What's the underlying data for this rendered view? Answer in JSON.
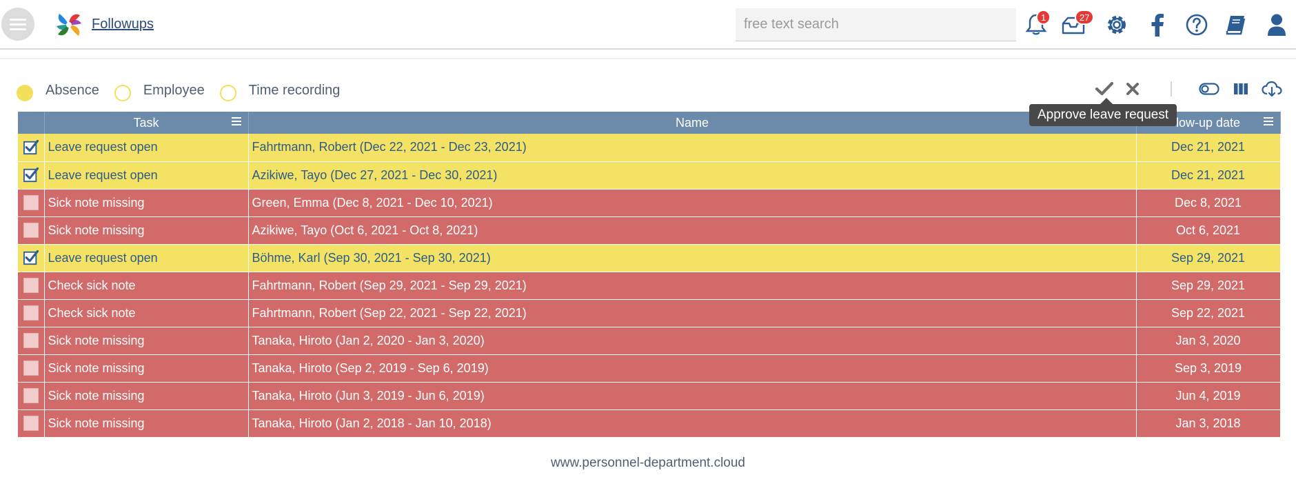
{
  "header": {
    "title": "Followups",
    "search_placeholder": "free text search",
    "notifications_count": "1",
    "messages_count": "27"
  },
  "filters": [
    {
      "label": "Absence",
      "selected": true
    },
    {
      "label": "Employee",
      "selected": false
    },
    {
      "label": "Time recording",
      "selected": false
    }
  ],
  "toolbar": {
    "tooltip": "Approve leave request"
  },
  "table": {
    "columns": {
      "task": "Task",
      "name": "Name",
      "date": "low-up date"
    },
    "rows": [
      {
        "checked": true,
        "task": "Leave request open",
        "name": "Fahrtmann, Robert (Dec 22, 2021 - Dec 23, 2021)",
        "date": "Dec 21, 2021",
        "status": "yellow"
      },
      {
        "checked": true,
        "task": "Leave request open",
        "name": "Azikiwe, Tayo (Dec 27, 2021 - Dec 30, 2021)",
        "date": "Dec 21, 2021",
        "status": "yellow"
      },
      {
        "checked": false,
        "task": "Sick note missing",
        "name": "Green, Emma (Dec 8, 2021 - Dec 10, 2021)",
        "date": "Dec 8, 2021",
        "status": "red"
      },
      {
        "checked": false,
        "task": "Sick note missing",
        "name": "Azikiwe, Tayo (Oct 6, 2021 - Oct 8, 2021)",
        "date": "Oct 6, 2021",
        "status": "red"
      },
      {
        "checked": true,
        "task": "Leave request open",
        "name": "Böhme, Karl (Sep 30, 2021 - Sep 30, 2021)",
        "date": "Sep 29, 2021",
        "status": "yellow"
      },
      {
        "checked": false,
        "task": "Check sick note",
        "name": "Fahrtmann, Robert (Sep 29, 2021 - Sep 29, 2021)",
        "date": "Sep 29, 2021",
        "status": "red"
      },
      {
        "checked": false,
        "task": "Check sick note",
        "name": "Fahrtmann, Robert (Sep 22, 2021 - Sep 22, 2021)",
        "date": "Sep 22, 2021",
        "status": "red"
      },
      {
        "checked": false,
        "task": "Sick note missing",
        "name": "Tanaka, Hiroto (Jan 2, 2020 - Jan 3, 2020)",
        "date": "Jan 3, 2020",
        "status": "red"
      },
      {
        "checked": false,
        "task": "Sick note missing",
        "name": "Tanaka, Hiroto (Sep 2, 2019 - Sep 6, 2019)",
        "date": "Sep 3, 2019",
        "status": "red"
      },
      {
        "checked": false,
        "task": "Sick note missing",
        "name": "Tanaka, Hiroto (Jun 3, 2019 - Jun 6, 2019)",
        "date": "Jun 4, 2019",
        "status": "red"
      },
      {
        "checked": false,
        "task": "Sick note missing",
        "name": "Tanaka, Hiroto (Jan 2, 2018 - Jan 10, 2018)",
        "date": "Jan 3, 2018",
        "status": "red"
      }
    ]
  },
  "footer": {
    "text": "www.personnel-department.cloud"
  },
  "colors": {
    "header_bar": "#6c8aaa",
    "row_yellow": "#f3e263",
    "row_red": "#d26a6a",
    "accent": "#2c4a7c"
  },
  "icons": [
    "menu-icon",
    "app-logo",
    "bell-icon",
    "inbox-icon",
    "gear-icon",
    "facebook-icon",
    "help-icon",
    "book-icon",
    "user-icon",
    "check-icon",
    "close-icon",
    "toggle-icon",
    "columns-icon",
    "cloud-download-icon",
    "column-menu-icon"
  ]
}
